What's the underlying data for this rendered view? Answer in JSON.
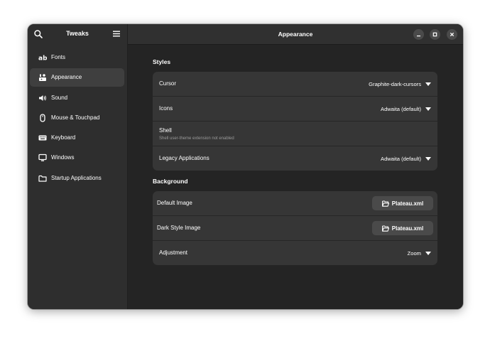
{
  "sidebar": {
    "title": "Tweaks",
    "items": [
      {
        "label": "Fonts",
        "icon": "font-ab-icon"
      },
      {
        "label": "Appearance",
        "icon": "appearance-icon",
        "active": true
      },
      {
        "label": "Sound",
        "icon": "speaker-icon"
      },
      {
        "label": "Mouse & Touchpad",
        "icon": "mouse-icon"
      },
      {
        "label": "Keyboard",
        "icon": "keyboard-icon"
      },
      {
        "label": "Windows",
        "icon": "monitor-icon"
      },
      {
        "label": "Startup Applications",
        "icon": "folder-icon"
      }
    ]
  },
  "header": {
    "title": "Appearance"
  },
  "styles": {
    "title": "Styles",
    "cursor": {
      "label": "Cursor",
      "value": "Graphite-dark-cursors"
    },
    "icons": {
      "label": "Icons",
      "value": "Adwaita (default)"
    },
    "shell": {
      "label": "Shell",
      "sub": "Shell user-theme extension not enabled"
    },
    "legacy": {
      "label": "Legacy Applications",
      "value": "Adwaita (default)"
    }
  },
  "background": {
    "title": "Background",
    "default_image": {
      "label": "Default Image",
      "file": "Plateau.xml"
    },
    "dark_image": {
      "label": "Dark Style Image",
      "file": "Plateau.xml"
    },
    "adjustment": {
      "label": "Adjustment",
      "value": "Zoom"
    }
  },
  "colors": {
    "window_bg": "#242424",
    "sidebar_bg": "#2e2e2e",
    "card_bg": "#363636",
    "button_bg": "#4a4a4a"
  }
}
